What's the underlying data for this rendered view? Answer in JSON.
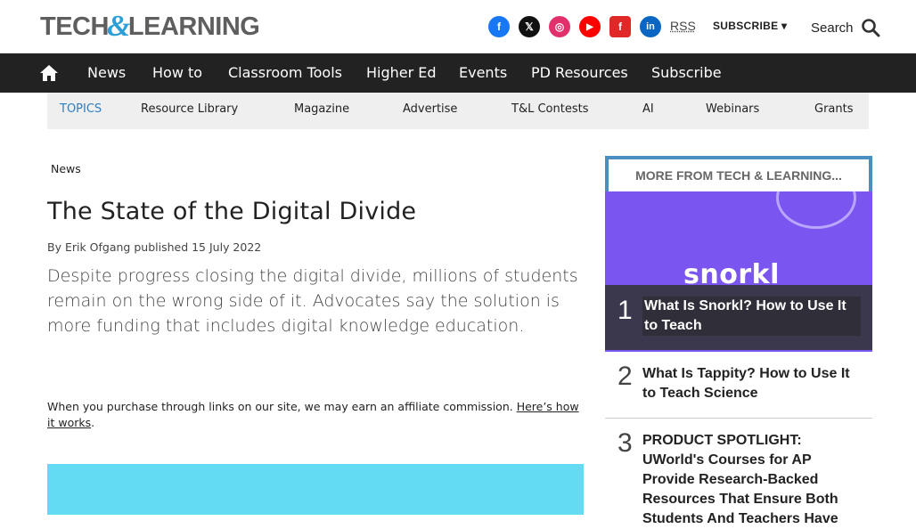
{
  "header": {
    "logo_left": "TECH",
    "logo_amp": "&",
    "logo_right": "LEARNING",
    "rss": "RSS",
    "subscribe": "SUBSCRIBE ▾",
    "search": "Search",
    "social_icons": [
      {
        "name": "facebook-icon",
        "glyph": "f",
        "color": "#1877f2"
      },
      {
        "name": "x-icon",
        "glyph": "𝕏",
        "color": "#111111"
      },
      {
        "name": "instagram-icon",
        "glyph": "◎",
        "color": "#e1306c"
      },
      {
        "name": "youtube-icon",
        "glyph": "▶",
        "color": "#ff0000"
      },
      {
        "name": "flipboard-icon",
        "glyph": "f",
        "color": "#e12828"
      },
      {
        "name": "linkedin-icon",
        "glyph": "in",
        "color": "#0a66c2"
      }
    ]
  },
  "nav": {
    "items": [
      "News",
      "How to",
      "Classroom Tools",
      "Higher Ed",
      "Events",
      "PD Resources",
      "Subscribe"
    ]
  },
  "topics": {
    "label": "TOPICS",
    "items": [
      "Resource Library",
      "Magazine",
      "Advertise",
      "T&L Contests",
      "AI",
      "Webinars",
      "Grants"
    ]
  },
  "article": {
    "breadcrumb": "News",
    "title": "The State of the Digital Divide",
    "byline": "By Erik Ofgang published 15 July 2022",
    "strapline": "Despite progress closing the digital divide, millions of students remain on the wrong side of it. Advocates say the solution is more funding that includes digital knowledge education.",
    "affiliate_text": "When you purchase through links on our site, we may earn an affiliate commission. ",
    "affiliate_link": "Here’s how it works",
    "affiliate_end": "."
  },
  "sidebar": {
    "heading": "MORE FROM TECH & LEARNING...",
    "image_text": "snorkl",
    "items": [
      {
        "num": "1",
        "title": "What Is Snorkl? How to Use It to Teach"
      },
      {
        "num": "2",
        "title": "What Is Tappity? How to Use It to Teach Science"
      },
      {
        "num": "3",
        "title": "PRODUCT SPOTLIGHT: UWorld's Courses for AP Provide Research-Backed Resources That Ensure Both Students And Teachers Have"
      }
    ]
  },
  "colors": {
    "nav_bg": "#222222",
    "accent_blue": "#2b7fc4",
    "sidebar_border": "#4a8fc0",
    "snorkl_purple": "#7b55f0",
    "hero_cyan": "#63dcf3"
  }
}
